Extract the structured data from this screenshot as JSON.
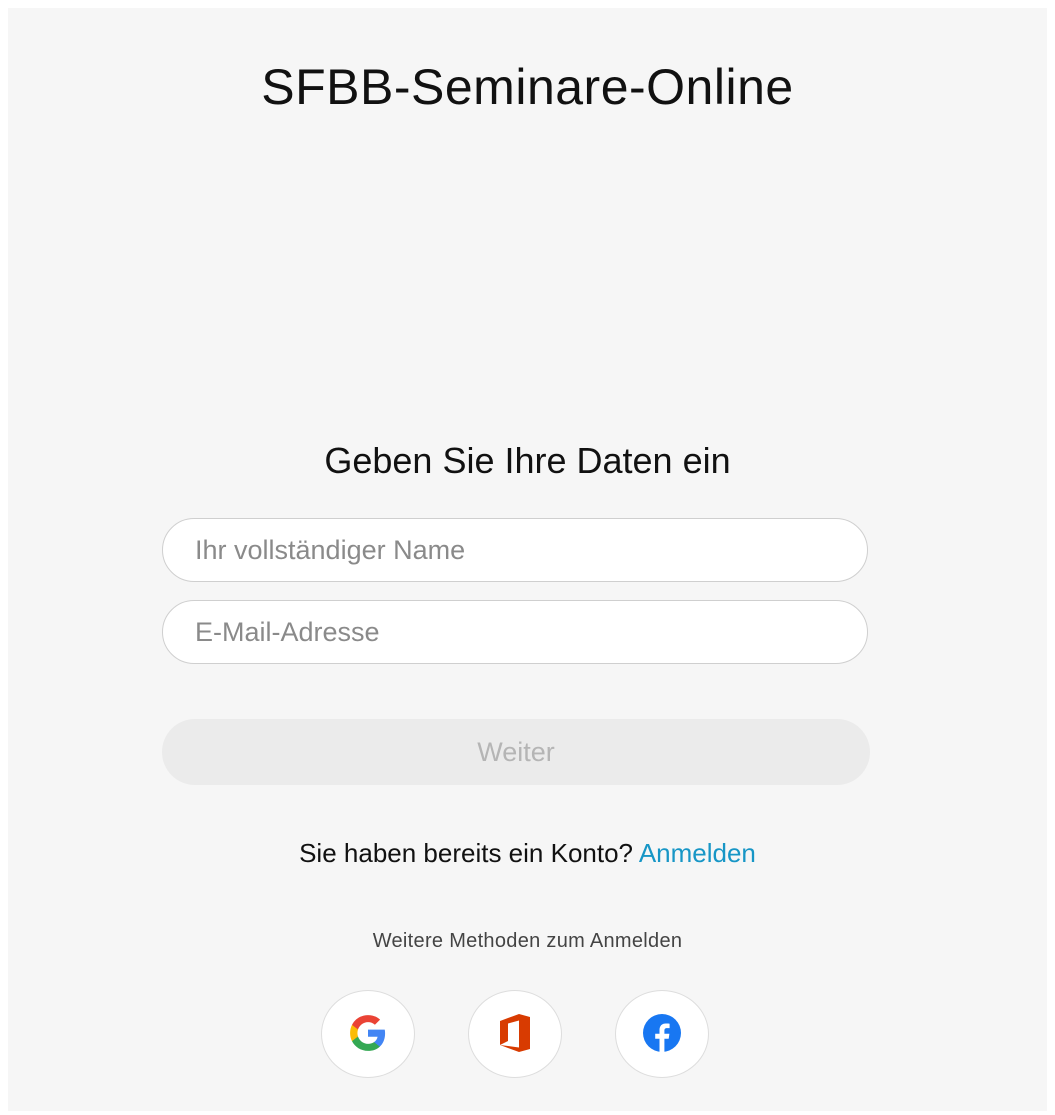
{
  "app": {
    "title": "SFBB-Seminare-Online"
  },
  "form": {
    "heading": "Geben Sie Ihre Daten ein",
    "name_field": {
      "placeholder": "Ihr vollständiger Name",
      "value": ""
    },
    "email_field": {
      "placeholder": "E-Mail-Adresse",
      "value": ""
    },
    "continue_label": "Weiter"
  },
  "signin": {
    "prompt": "Sie haben bereits ein Konto?",
    "link_label": "Anmelden"
  },
  "other_methods": {
    "label": "Weitere Methoden zum Anmelden",
    "providers": [
      {
        "icon": "google-icon"
      },
      {
        "icon": "office-icon"
      },
      {
        "icon": "facebook-icon"
      }
    ]
  },
  "colors": {
    "panel_background": "#f6f6f6",
    "link": "#1796c6",
    "button_disabled_bg": "#ebebeb",
    "button_disabled_text": "#b5b5b5",
    "google_blue": "#4285f4",
    "google_red": "#ea4335",
    "google_yellow": "#fbbc05",
    "google_green": "#34a853",
    "office_orange": "#d83b01",
    "facebook_blue": "#1877f2"
  }
}
